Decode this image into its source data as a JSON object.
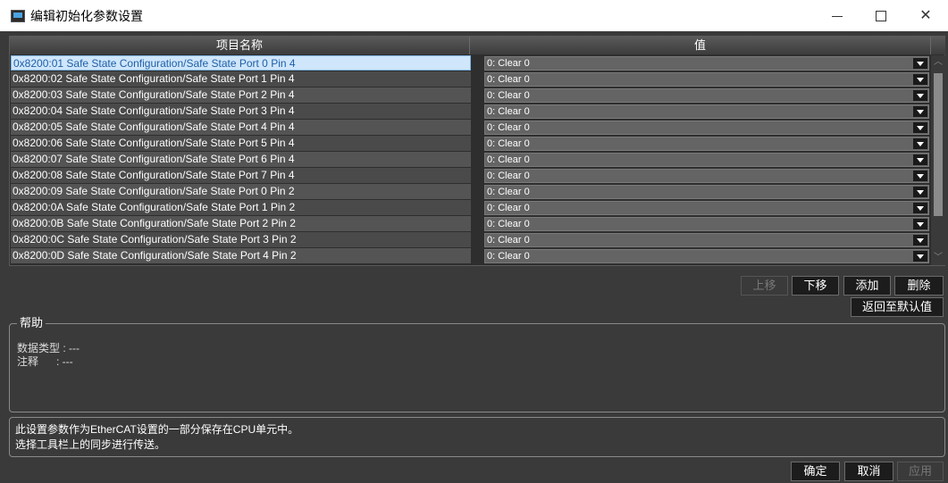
{
  "window": {
    "title": "编辑初始化参数设置",
    "min_glyph": "",
    "max_glyph": "",
    "close_glyph": "✕"
  },
  "table": {
    "headers": {
      "name": "项目名称",
      "value": "值"
    },
    "rows": [
      {
        "name": "0x8200:01 Safe State Configuration/Safe State Port 0 Pin 4",
        "value": "0: Clear 0",
        "selected": true
      },
      {
        "name": "0x8200:02 Safe State Configuration/Safe State Port 1 Pin 4",
        "value": "0: Clear 0"
      },
      {
        "name": "0x8200:03 Safe State Configuration/Safe State Port 2 Pin 4",
        "value": "0: Clear 0"
      },
      {
        "name": "0x8200:04 Safe State Configuration/Safe State Port 3 Pin 4",
        "value": "0: Clear 0"
      },
      {
        "name": "0x8200:05 Safe State Configuration/Safe State Port 4 Pin 4",
        "value": "0: Clear 0"
      },
      {
        "name": "0x8200:06 Safe State Configuration/Safe State Port 5 Pin 4",
        "value": "0: Clear 0"
      },
      {
        "name": "0x8200:07 Safe State Configuration/Safe State Port 6 Pin 4",
        "value": "0: Clear 0"
      },
      {
        "name": "0x8200:08 Safe State Configuration/Safe State Port 7 Pin 4",
        "value": "0: Clear 0"
      },
      {
        "name": "0x8200:09 Safe State Configuration/Safe State Port 0 Pin 2",
        "value": "0: Clear 0"
      },
      {
        "name": "0x8200:0A Safe State Configuration/Safe State Port 1 Pin 2",
        "value": "0: Clear 0"
      },
      {
        "name": "0x8200:0B Safe State Configuration/Safe State Port 2 Pin 2",
        "value": "0: Clear 0"
      },
      {
        "name": "0x8200:0C Safe State Configuration/Safe State Port 3 Pin 2",
        "value": "0: Clear 0"
      },
      {
        "name": "0x8200:0D Safe State Configuration/Safe State Port 4 Pin 2",
        "value": "0: Clear 0"
      }
    ]
  },
  "actions": {
    "move_up": "上移",
    "move_down": "下移",
    "add": "添加",
    "delete": "删除",
    "reset_default": "返回至默认值"
  },
  "help": {
    "legend": "帮助",
    "data_type": "数据类型 : ---",
    "comment": "注释      : ---"
  },
  "info": {
    "line1": "此设置参数作为EtherCAT设置的一部分保存在CPU单元中。",
    "line2": "选择工具栏上的同步进行传送。"
  },
  "footer": {
    "ok": "确定",
    "cancel": "取消",
    "apply": "应用"
  },
  "colors": {
    "background": "#3a3a3a",
    "selected_row": "#cfe6fb",
    "selected_text": "#1f5fa8"
  }
}
